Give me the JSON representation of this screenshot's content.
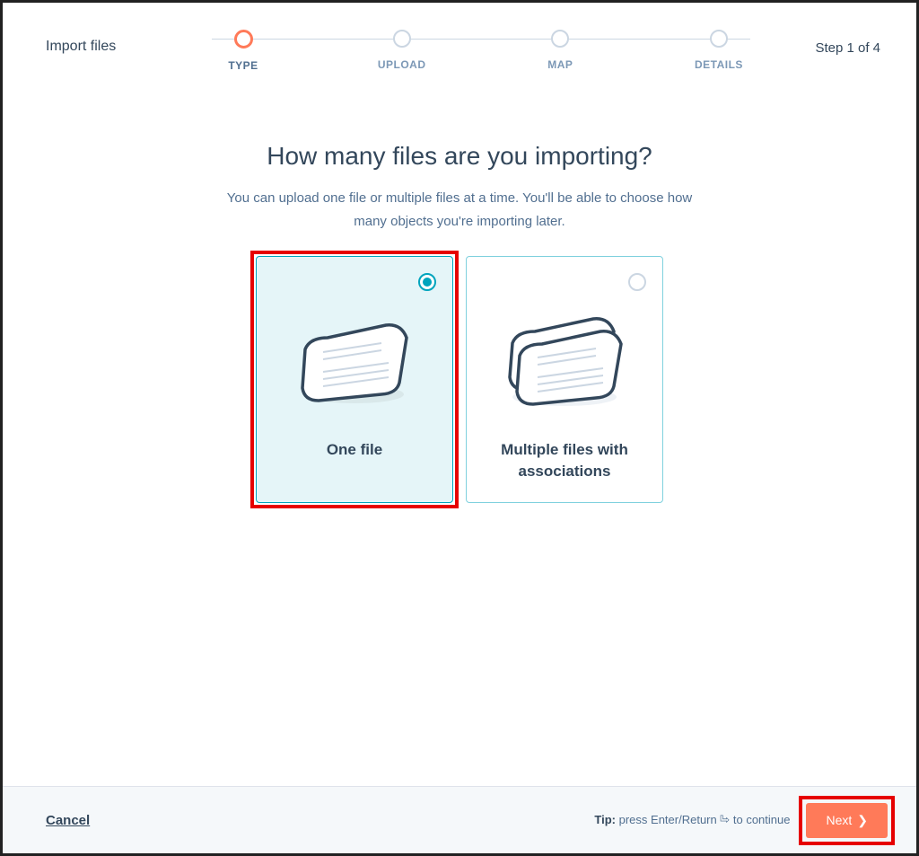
{
  "header": {
    "title": "Import files",
    "step_indicator": "Step 1 of 4",
    "steps": [
      {
        "label": "TYPE",
        "active": true
      },
      {
        "label": "UPLOAD",
        "active": false
      },
      {
        "label": "MAP",
        "active": false
      },
      {
        "label": "DETAILS",
        "active": false
      }
    ]
  },
  "main": {
    "heading": "How many files are you importing?",
    "subheading": "You can upload one file or multiple files at a time. You'll be able to choose how many objects you're importing later.",
    "options": [
      {
        "title": "One file",
        "selected": true
      },
      {
        "title": "Multiple files with associations",
        "selected": false
      }
    ]
  },
  "footer": {
    "cancel": "Cancel",
    "tip_label": "Tip:",
    "tip_text": " press Enter/Return ",
    "tip_text2": " to continue",
    "next": "Next"
  }
}
